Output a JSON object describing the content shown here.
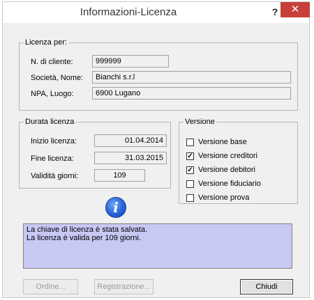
{
  "window": {
    "title": "Informazioni-Licenza",
    "help_label": "?",
    "close_label": "✕"
  },
  "licenza_per": {
    "legend": "Licenza per:",
    "fields": [
      {
        "label": "N. di cliente:",
        "value": "999999"
      },
      {
        "label": "Società, Nome:",
        "value": "Bianchi s.r.l"
      },
      {
        "label": "NPA, Luogo:",
        "value": "6900 Lugano"
      }
    ]
  },
  "durata": {
    "legend": "Durata licenza",
    "fields": [
      {
        "label": "Inizio licenza:",
        "value": "01.04.2014"
      },
      {
        "label": "Fine licenza:",
        "value": "31.03.2015"
      },
      {
        "label": "Validità giorni:",
        "value": "109"
      }
    ]
  },
  "versione": {
    "legend": "Versione",
    "items": [
      {
        "label": "Versione  base",
        "checked": false
      },
      {
        "label": "Versione creditori",
        "checked": true
      },
      {
        "label": "Versione debitori",
        "checked": true
      },
      {
        "label": "Versione fiduciario",
        "checked": false
      },
      {
        "label": "Versione prova",
        "checked": false
      }
    ]
  },
  "icon": {
    "name": "info-icon",
    "glyph": "i"
  },
  "message": {
    "lines": [
      "La chiave di licenza è stata salvata.",
      "La licenza è valida per 109 giorni."
    ]
  },
  "buttons": {
    "ordine": "Ordine...",
    "registrazione": "Registrazione...",
    "chiudi": "Chiudi"
  }
}
